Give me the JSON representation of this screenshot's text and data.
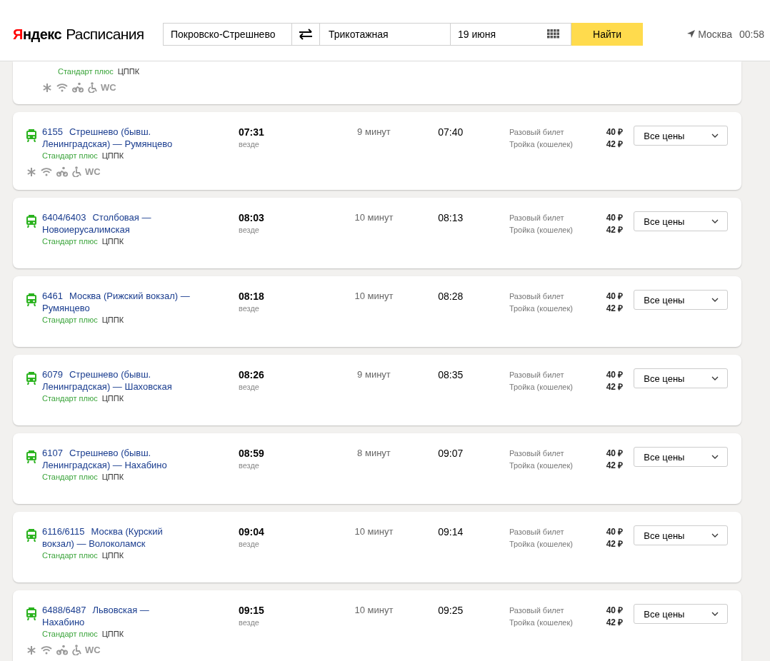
{
  "header": {
    "brand": "Яндекс",
    "product": "Расписания",
    "from": "Покровско-Стрешнево",
    "to": "Трикотажная",
    "date": "19 июня",
    "search_button": "Найти",
    "city": "Москва",
    "time": "00:58"
  },
  "partial_train": {
    "carrier_class": "Стандарт плюс",
    "carrier": "ЦППК",
    "amenities": true,
    "wc": "WC"
  },
  "trains": [
    {
      "number": "6155",
      "title": "Стрешнево (бывш. Ленинградская) — Румянцево",
      "carrier_class": "Стандарт плюс",
      "carrier": "ЦППК",
      "departure": "07:31",
      "departure_note": "везде",
      "duration": "9 минут",
      "arrival": "07:40",
      "fares": [
        {
          "name": "Разовый билет",
          "price": "40 ₽"
        },
        {
          "name": "Тройка (кошелек)",
          "price": "42 ₽"
        }
      ],
      "prices_button": "Все цены",
      "amenities": true,
      "wc": "WC"
    },
    {
      "number": "6404/6403",
      "title": "Столбовая — Новоиерусалимская",
      "carrier_class": "Стандарт плюс",
      "carrier": "ЦППК",
      "departure": "08:03",
      "departure_note": "везде",
      "duration": "10 минут",
      "arrival": "08:13",
      "fares": [
        {
          "name": "Разовый билет",
          "price": "40 ₽"
        },
        {
          "name": "Тройка (кошелек)",
          "price": "42 ₽"
        }
      ],
      "prices_button": "Все цены",
      "amenities": false
    },
    {
      "number": "6461",
      "title": "Москва (Рижский вокзал) — Румянцево",
      "carrier_class": "Стандарт плюс",
      "carrier": "ЦППК",
      "departure": "08:18",
      "departure_note": "везде",
      "duration": "10 минут",
      "arrival": "08:28",
      "fares": [
        {
          "name": "Разовый билет",
          "price": "40 ₽"
        },
        {
          "name": "Тройка (кошелек)",
          "price": "42 ₽"
        }
      ],
      "prices_button": "Все цены",
      "amenities": false
    },
    {
      "number": "6079",
      "title": "Стрешнево (бывш. Ленинградская) — Шаховская",
      "carrier_class": "Стандарт плюс",
      "carrier": "ЦППК",
      "departure": "08:26",
      "departure_note": "везде",
      "duration": "9 минут",
      "arrival": "08:35",
      "fares": [
        {
          "name": "Разовый билет",
          "price": "40 ₽"
        },
        {
          "name": "Тройка (кошелек)",
          "price": "42 ₽"
        }
      ],
      "prices_button": "Все цены",
      "amenities": false
    },
    {
      "number": "6107",
      "title": "Стрешнево (бывш. Ленинградская) — Нахабино",
      "carrier_class": "Стандарт плюс",
      "carrier": "ЦППК",
      "departure": "08:59",
      "departure_note": "везде",
      "duration": "8 минут",
      "arrival": "09:07",
      "fares": [
        {
          "name": "Разовый билет",
          "price": "40 ₽"
        },
        {
          "name": "Тройка (кошелек)",
          "price": "42 ₽"
        }
      ],
      "prices_button": "Все цены",
      "amenities": false
    },
    {
      "number": "6116/6115",
      "title": "Москва (Курский вокзал) — Волоколамск",
      "carrier_class": "Стандарт плюс",
      "carrier": "ЦППК",
      "departure": "09:04",
      "departure_note": "везде",
      "duration": "10 минут",
      "arrival": "09:14",
      "fares": [
        {
          "name": "Разовый билет",
          "price": "40 ₽"
        },
        {
          "name": "Тройка (кошелек)",
          "price": "42 ₽"
        }
      ],
      "prices_button": "Все цены",
      "amenities": false
    },
    {
      "number": "6488/6487",
      "title": "Львовская — Нахабино",
      "carrier_class": "Стандарт плюс",
      "carrier": "ЦППК",
      "departure": "09:15",
      "departure_note": "везде",
      "duration": "10 минут",
      "arrival": "09:25",
      "fares": [
        {
          "name": "Разовый билет",
          "price": "40 ₽"
        },
        {
          "name": "Тройка (кошелек)",
          "price": "42 ₽"
        }
      ],
      "prices_button": "Все цены",
      "amenities": true,
      "wc": "WC"
    }
  ]
}
